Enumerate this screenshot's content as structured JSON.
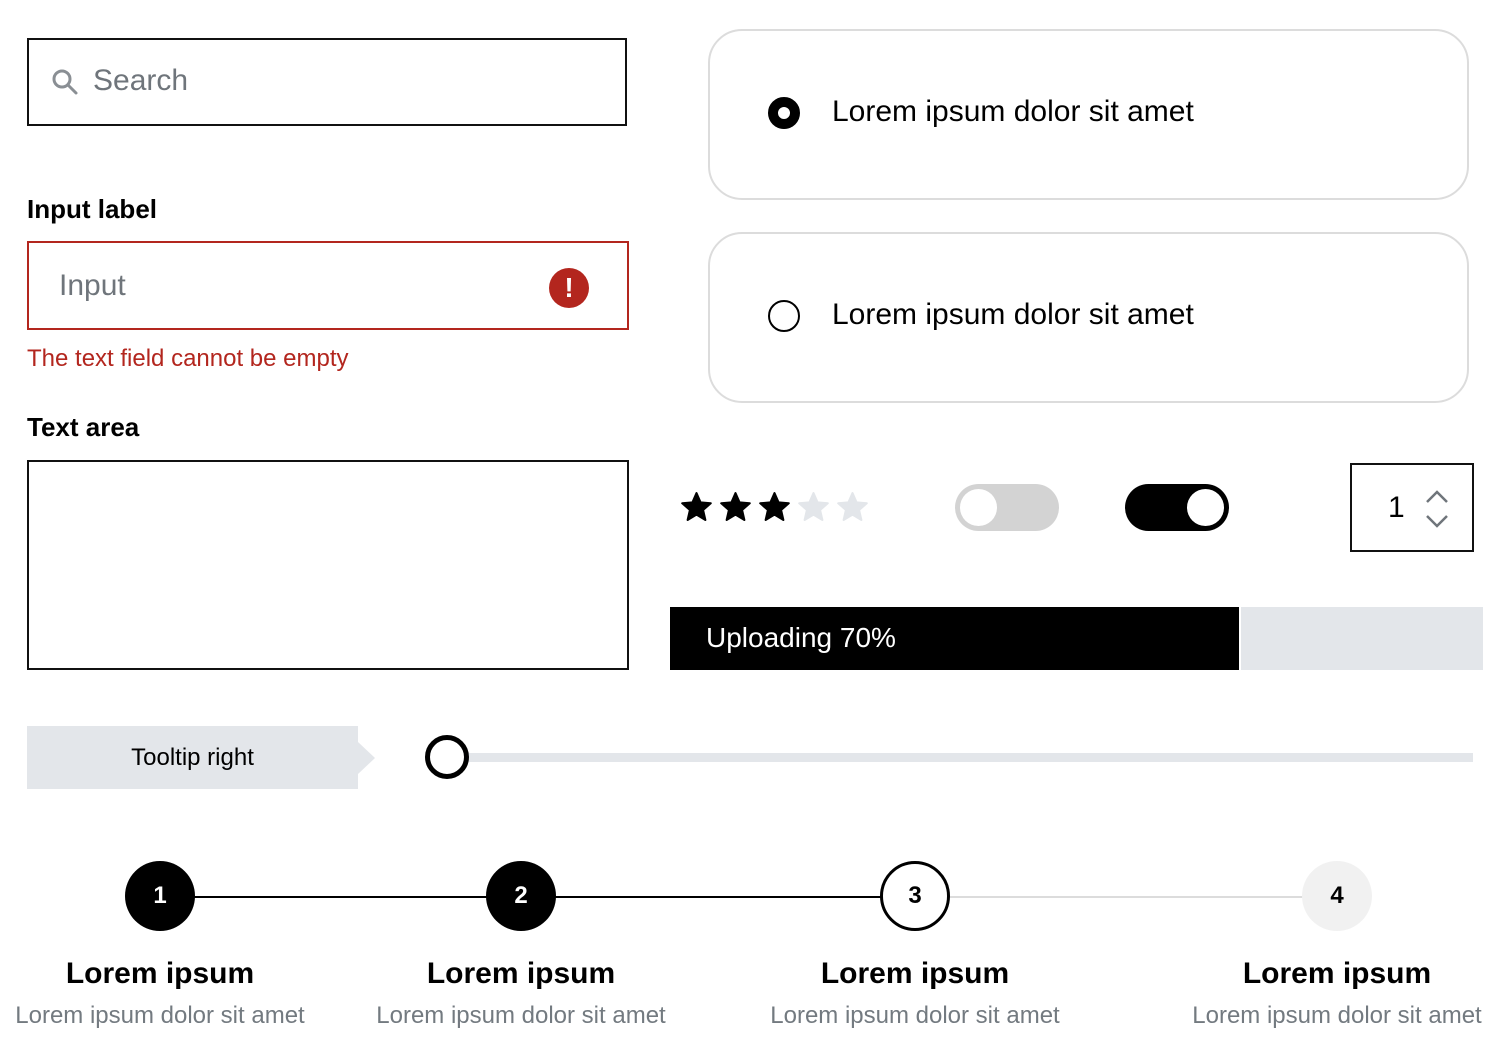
{
  "search": {
    "placeholder": "Search",
    "icon": "search-icon"
  },
  "input_field": {
    "label": "Input label",
    "placeholder": "Input",
    "error_icon": "!",
    "error_message": "The text field cannot be empty",
    "error_color": "#b3261e"
  },
  "text_area": {
    "label": "Text area",
    "value": ""
  },
  "radio_options": [
    {
      "label": "Lorem ipsum dolor sit amet",
      "checked": true
    },
    {
      "label": "Lorem ipsum dolor sit amet",
      "checked": false
    }
  ],
  "rating": {
    "value": 3,
    "max": 5
  },
  "toggles": [
    {
      "on": false
    },
    {
      "on": true
    }
  ],
  "number_stepper": {
    "value": "1"
  },
  "progress": {
    "label": "Uploading 70%",
    "percent": 70
  },
  "tooltip": {
    "label": "Tooltip right"
  },
  "slider": {
    "value_fraction": 0.0
  },
  "steps": [
    {
      "number": "1",
      "title": "Lorem ipsum",
      "description": "Lorem ipsum dolor sit amet",
      "state": "done"
    },
    {
      "number": "2",
      "title": "Lorem ipsum",
      "description": "Lorem ipsum dolor sit amet",
      "state": "done"
    },
    {
      "number": "3",
      "title": "Lorem ipsum",
      "description": "Lorem ipsum dolor sit amet",
      "state": "current"
    },
    {
      "number": "4",
      "title": "Lorem ipsum",
      "description": "Lorem ipsum dolor sit amet",
      "state": "todo"
    }
  ],
  "colors": {
    "accent": "#000000",
    "error": "#b3261e",
    "muted": "#e3e6ea",
    "placeholder": "#6f757b"
  }
}
